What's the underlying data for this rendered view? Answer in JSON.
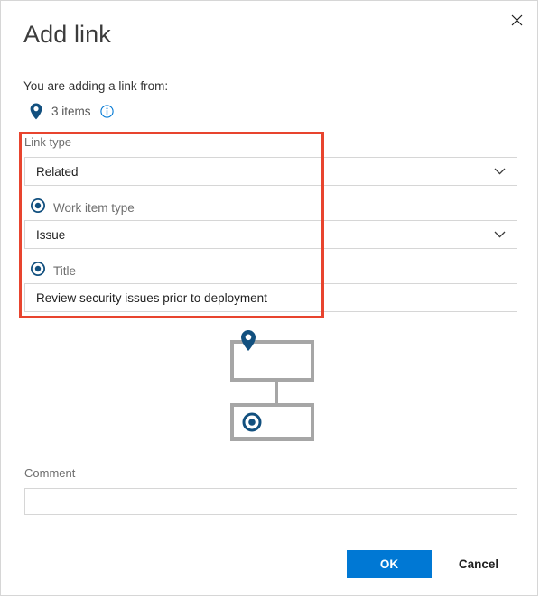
{
  "dialog": {
    "title": "Add link",
    "close_icon": "close-icon",
    "source_label": "You are adding a link from:",
    "items_count_text": "3 items",
    "pin_icon": "map-pin-icon",
    "info_icon": "info-icon",
    "highlight_color": "#e8442e"
  },
  "form": {
    "link_type": {
      "label": "Link type",
      "value": "Related",
      "placeholder": "",
      "chevron_icon": "chevron-down-icon"
    },
    "work_item_type": {
      "label": "Work item type",
      "radio_icon": "radio-selected-icon",
      "value": "Issue",
      "placeholder": "",
      "chevron_icon": "chevron-down-icon"
    },
    "title": {
      "label": "Title",
      "radio_icon": "radio-selected-icon",
      "value": "Review security issues prior to deployment",
      "placeholder": ""
    },
    "comment": {
      "label": "Comment",
      "value": "",
      "placeholder": ""
    }
  },
  "diagram": {
    "top_node_icon": "map-pin-icon",
    "bottom_node_icon": "radio-selected-icon",
    "node_border_color": "#a6a6a6",
    "accent_color": "#12507f"
  },
  "footer": {
    "ok_label": "OK",
    "cancel_label": "Cancel",
    "ok_color": "#0078d4"
  }
}
